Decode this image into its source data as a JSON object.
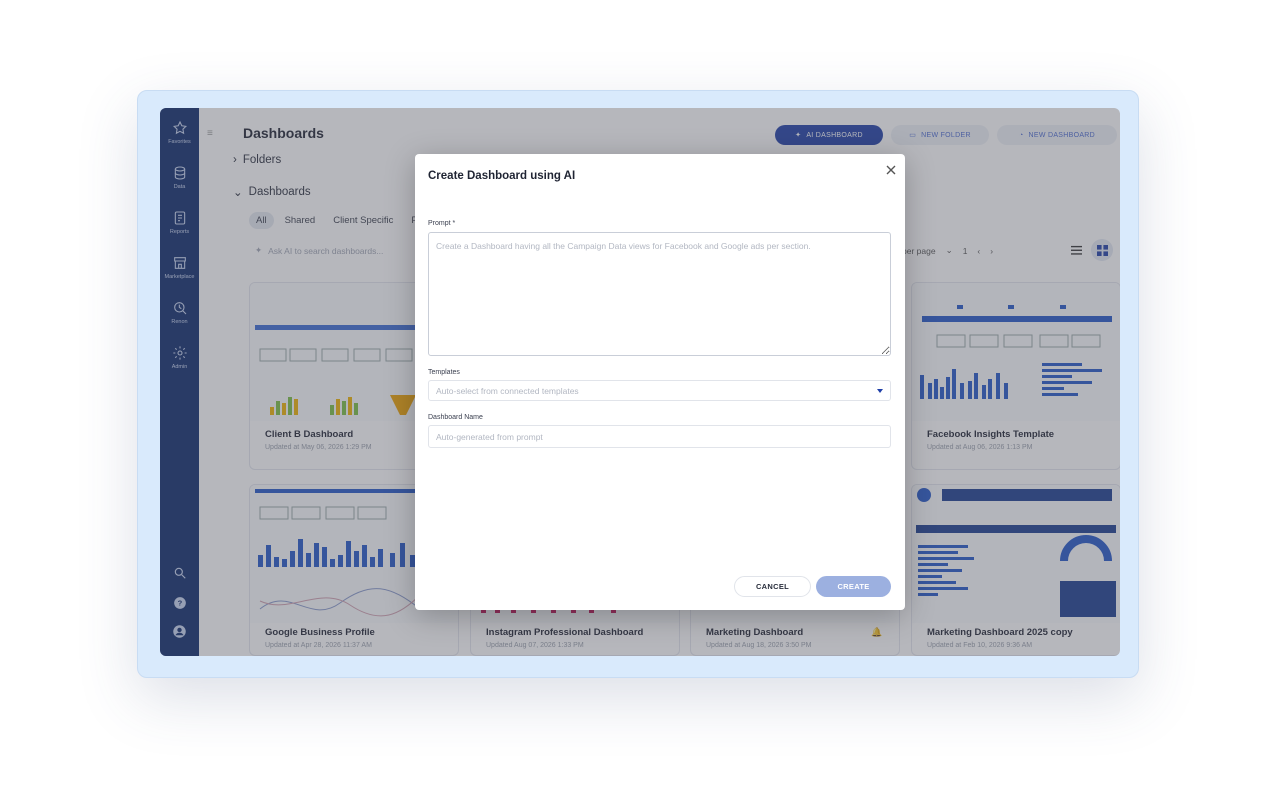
{
  "sidebar": {
    "items": [
      {
        "label": "Favorites",
        "icon": "star-icon"
      },
      {
        "label": "Data",
        "icon": "database-icon"
      },
      {
        "label": "Reports",
        "icon": "report-icon"
      },
      {
        "label": "Marketplace",
        "icon": "store-icon"
      },
      {
        "label": "Renon",
        "icon": "radar-icon"
      },
      {
        "label": "Admin",
        "icon": "gear-icon"
      }
    ],
    "bottom": [
      "search-icon",
      "help-icon",
      "account-icon"
    ]
  },
  "header": {
    "title": "Dashboards",
    "ai_button": "AI DASHBOARD",
    "folder_button": "NEW FOLDER",
    "dashboard_button": "NEW DASHBOARD"
  },
  "sections": {
    "folders": "Folders",
    "dashboards": "Dashboards"
  },
  "filters": [
    "All",
    "Shared",
    "Client Specific",
    "Pr"
  ],
  "search": {
    "placeholder": "Ask AI to search dashboards..."
  },
  "pager": {
    "per_page": "per page",
    "page": "1"
  },
  "cards": [
    {
      "title": "Client B Dashboard",
      "updated": "Updated at May 06, 2026 1:29 PM"
    },
    {
      "title": "Facebook Insights Template",
      "updated": "Updated at Aug 06, 2026 1:13 PM"
    },
    {
      "title": "Google Business Profile",
      "updated": "Updated at Apr 28, 2026 11:37 AM"
    },
    {
      "title": "Instagram Professional Dashboard",
      "updated": "Updated Aug 07, 2026 1:33 PM"
    },
    {
      "title": "Marketing Dashboard",
      "updated": "Updated at Aug 18, 2026 3:50 PM"
    },
    {
      "title": "Marketing Dashboard 2025 copy",
      "updated": "Updated at Feb 10, 2026 9:36 AM"
    }
  ],
  "modal": {
    "title": "Create Dashboard using AI",
    "prompt_label": "Prompt *",
    "prompt_placeholder": "Create a Dashboard having all the Campaign Data views for Facebook and Google ads per section.",
    "templates_label": "Templates",
    "templates_value": "Auto-select from connected templates",
    "name_label": "Dashboard Name",
    "name_placeholder": "Auto-generated from prompt",
    "cancel": "CANCEL",
    "create": "CREATE"
  },
  "colors": {
    "sidebar": "#0d2a6b",
    "primary": "#1f3fa8",
    "create_disabled": "#9cb0e0",
    "frame": "#d9eafc"
  }
}
